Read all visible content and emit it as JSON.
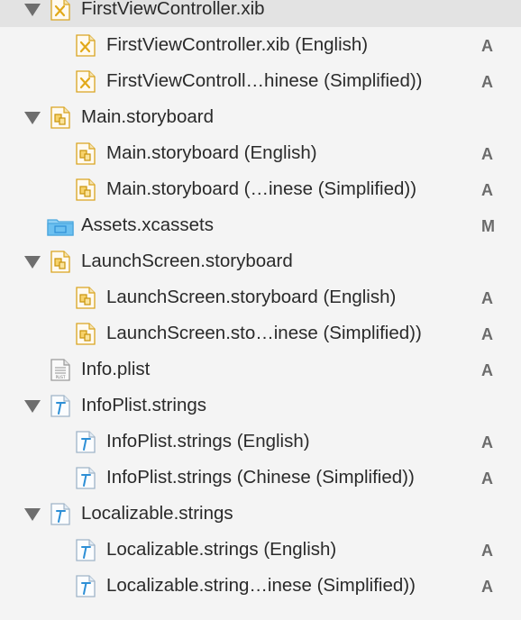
{
  "rows": [
    {
      "label": "FirstViewController.xib",
      "status": ""
    },
    {
      "label": "FirstViewController.xib (English)",
      "status": "A"
    },
    {
      "label": "FirstViewControll…hinese (Simplified))",
      "status": "A"
    },
    {
      "label": "Main.storyboard",
      "status": ""
    },
    {
      "label": "Main.storyboard (English)",
      "status": "A"
    },
    {
      "label": "Main.storyboard (…inese (Simplified))",
      "status": "A"
    },
    {
      "label": "Assets.xcassets",
      "status": "M"
    },
    {
      "label": "LaunchScreen.storyboard",
      "status": ""
    },
    {
      "label": "LaunchScreen.storyboard (English)",
      "status": "A"
    },
    {
      "label": "LaunchScreen.sto…inese (Simplified))",
      "status": "A"
    },
    {
      "label": "Info.plist",
      "status": "A"
    },
    {
      "label": "InfoPlist.strings",
      "status": ""
    },
    {
      "label": "InfoPlist.strings (English)",
      "status": "A"
    },
    {
      "label": "InfoPlist.strings (Chinese (Simplified))",
      "status": "A"
    },
    {
      "label": "Localizable.strings",
      "status": ""
    },
    {
      "label": "Localizable.strings (English)",
      "status": "A"
    },
    {
      "label": "Localizable.string…inese (Simplified))",
      "status": "A"
    }
  ],
  "colors": {
    "selection": "#e3e3e3",
    "status": "#6b6b6b",
    "xib_icon": "#e8b42a",
    "folder_icon": "#5ab4ea",
    "strings_icon": "#2d8fd6"
  }
}
